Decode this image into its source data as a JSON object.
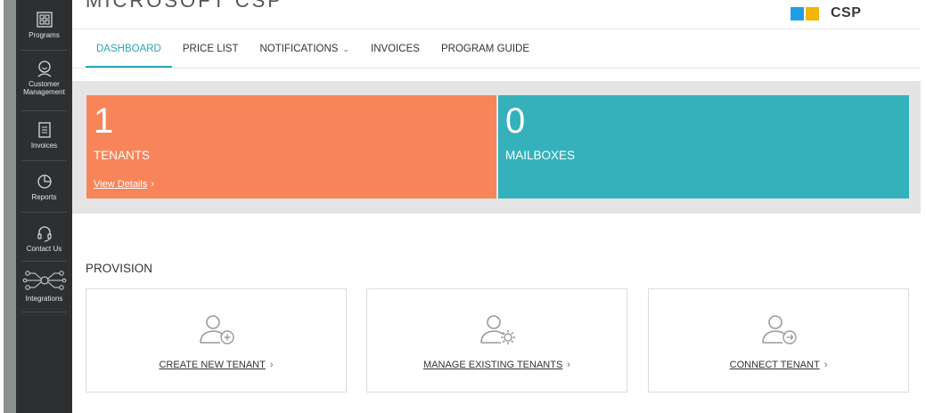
{
  "header": {
    "title": "MICROSOFT CSP",
    "logo_text": "CSP",
    "logo_colors": [
      "#1f9ee8",
      "#f4b400"
    ]
  },
  "sidebar": {
    "items": [
      {
        "label": "Programs",
        "icon": "grid-icon"
      },
      {
        "label": "Customer Management",
        "icon": "user-smile-icon"
      },
      {
        "label": "Invoices",
        "icon": "document-icon"
      },
      {
        "label": "Reports",
        "icon": "pie-chart-icon"
      },
      {
        "label": "Contact Us",
        "icon": "headset-icon"
      },
      {
        "label": "Integrations",
        "icon": "network-icon"
      }
    ]
  },
  "nav": {
    "tabs": [
      {
        "label": "DASHBOARD",
        "active": true
      },
      {
        "label": "PRICE LIST"
      },
      {
        "label": "NOTIFICATIONS",
        "dropdown": true
      },
      {
        "label": "INVOICES"
      },
      {
        "label": "PROGRAM GUIDE"
      }
    ],
    "dropdown_glyph": "⌄",
    "accent_color": "#2aa7b8"
  },
  "stats": {
    "tenants": {
      "value": "1",
      "label": "TENANTS",
      "link": "View Details",
      "link_arrow": "›",
      "color": "#f8845a"
    },
    "mailboxes": {
      "value": "0",
      "label": "MAILBOXES",
      "color": "#35b1bb"
    }
  },
  "provision": {
    "title": "PROVISION",
    "arrow": "›",
    "cards": [
      {
        "label": "CREATE NEW TENANT",
        "icon": "user-add-icon"
      },
      {
        "label": "MANAGE EXISTING TENANTS",
        "icon": "user-settings-icon"
      },
      {
        "label": "CONNECT TENANT",
        "icon": "user-connect-icon"
      }
    ]
  }
}
